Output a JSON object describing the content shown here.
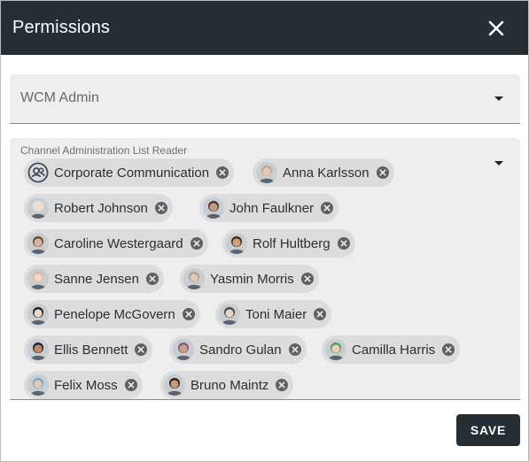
{
  "dialog": {
    "title": "Permissions",
    "close_icon": "close-icon",
    "header_color": "#262e34"
  },
  "role_select": {
    "value": "WCM Admin",
    "icon": "dropdown-caret-icon"
  },
  "permission_field": {
    "label": "Channel Administration List Reader",
    "icon": "dropdown-caret-icon",
    "chips": [
      {
        "label": "Corporate Communication",
        "type": "group",
        "avatar": "group-icon"
      },
      {
        "label": "Anna Karlsson",
        "type": "user",
        "avatar_color": "#e6c9b5",
        "hair": "#caa27c"
      },
      {
        "label": "Robert Johnson",
        "type": "user",
        "avatar_color": "#f0ddd0",
        "hair": "#e9e4df"
      },
      {
        "label": "John Faulkner",
        "type": "user",
        "avatar_color": "#c49a82",
        "hair": "#4a3328"
      },
      {
        "label": "Caroline Westergaard",
        "type": "user",
        "avatar_color": "#d8b29a",
        "hair": "#6a4632"
      },
      {
        "label": "Rolf Hultberg",
        "type": "user",
        "avatar_color": "#cf9f7e",
        "hair": "#3c2a20"
      },
      {
        "label": "Sanne Jensen",
        "type": "user",
        "avatar_color": "#f1d7c4",
        "hair": "#d9b99a"
      },
      {
        "label": "Yasmin Morris",
        "type": "user",
        "avatar_color": "#e2c8b0",
        "hair": "#a9a18c"
      },
      {
        "label": "Penelope McGovern",
        "type": "user",
        "avatar_color": "#f0d5c0",
        "hair": "#1d1a1a"
      },
      {
        "label": "Toni Maier",
        "type": "user",
        "avatar_color": "#e6d3c6",
        "hair": "#444444"
      },
      {
        "label": "Ellis Bennett",
        "type": "user",
        "avatar_color": "#b98a6a",
        "hair": "#222222"
      },
      {
        "label": "Sandro Gulan",
        "type": "user",
        "avatar_color": "#c9a08a",
        "hair": "#7a5b6f"
      },
      {
        "label": "Camilla Harris",
        "type": "user",
        "avatar_color": "#f0cfb4",
        "hair": "#4f9a5a"
      },
      {
        "label": "Felix Moss",
        "type": "user",
        "avatar_color": "#e9c6a8",
        "hair": "#6aa9d8"
      },
      {
        "label": "Bruno Maintz",
        "type": "user",
        "avatar_color": "#c79a7c",
        "hair": "#2a201b"
      }
    ],
    "remove_icon": "remove-chip-icon"
  },
  "actions": {
    "save_label": "SAVE"
  }
}
